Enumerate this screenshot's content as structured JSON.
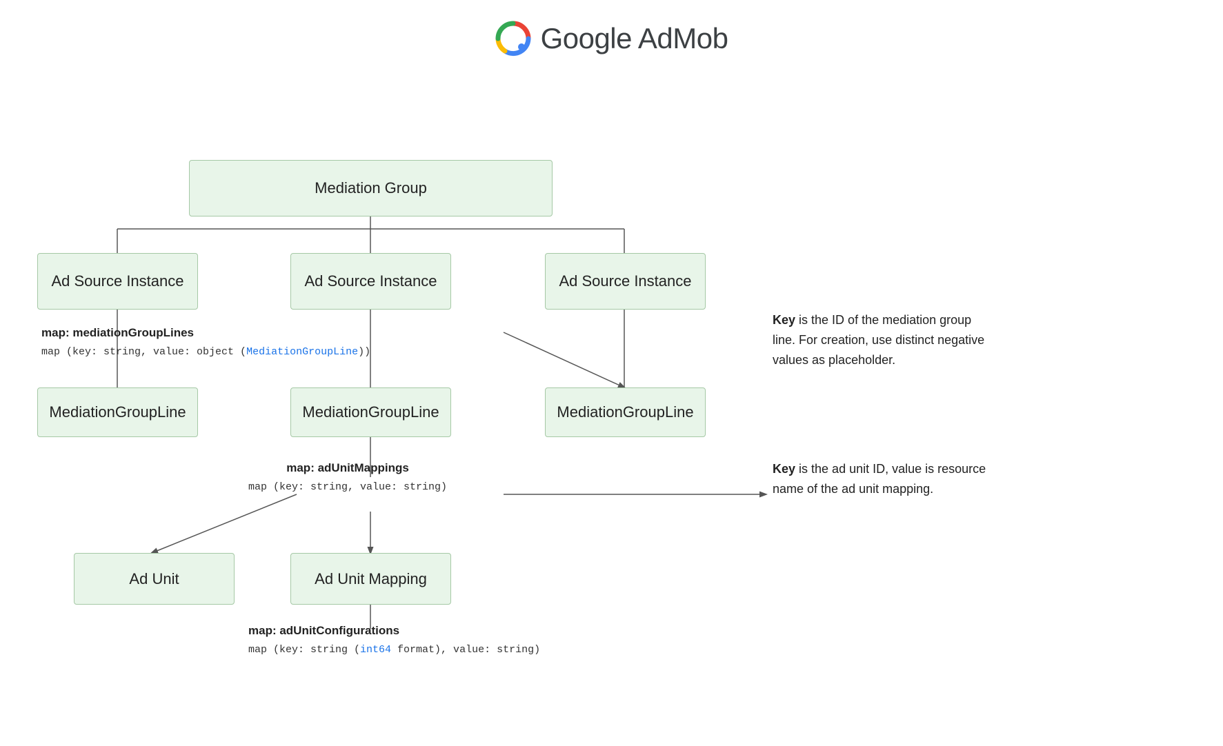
{
  "header": {
    "title": "Google AdMob",
    "logo_alt": "Google AdMob logo"
  },
  "diagram": {
    "boxes": {
      "mediation_group": {
        "label": "Mediation Group"
      },
      "ad_source_1": {
        "label": "Ad Source Instance"
      },
      "ad_source_2": {
        "label": "Ad Source Instance"
      },
      "ad_source_3": {
        "label": "Ad Source Instance"
      },
      "mediation_line_1": {
        "label": "MediationGroupLine"
      },
      "mediation_line_2": {
        "label": "MediationGroupLine"
      },
      "mediation_line_3": {
        "label": "MediationGroupLine"
      },
      "ad_unit": {
        "label": "Ad Unit"
      },
      "ad_unit_mapping": {
        "label": "Ad Unit Mapping"
      }
    },
    "annotations": {
      "map1_title": "map: mediationGroupLines",
      "map1_subtitle": "map (key: string, value: object (MediationGroupLine))",
      "map1_link": "MediationGroupLine",
      "map1_note_bold": "Key",
      "map1_note": " is the ID of the mediation group line. For creation, use distinct negative values as placeholder.",
      "map2_title": "map: adUnitMappings",
      "map2_subtitle": "map (key: string, value: string)",
      "map2_note_bold": "Key",
      "map2_note": " is the ad unit ID, value is resource name of the ad unit mapping.",
      "map3_title": "map: adUnitConfigurations",
      "map3_subtitle_prefix": "map (key: string (",
      "map3_subtitle_blue": "int64",
      "map3_subtitle_suffix": " format), value: string)"
    }
  }
}
